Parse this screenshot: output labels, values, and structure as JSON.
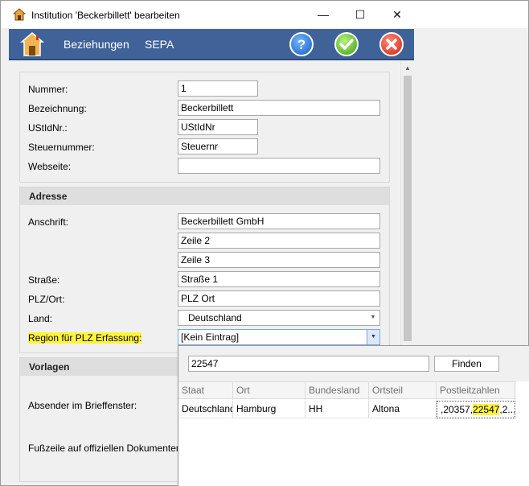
{
  "window": {
    "title": "Institution 'Beckerbillett' bearbeiten",
    "minimize": "—",
    "maximize": "☐",
    "close": "✕"
  },
  "toolbar": {
    "beziehungen": "Beziehungen",
    "sepa": "SEPA",
    "help": "?"
  },
  "general": {
    "nummer_label": "Nummer:",
    "nummer_value": "1",
    "bezeichnung_label": "Bezeichnung:",
    "bezeichnung_value": "Beckerbillett",
    "ustid_label": "UStIdNr.:",
    "ustid_value": "UStIdNr",
    "steuernummer_label": "Steuernummer:",
    "steuernummer_value": "Steuernr",
    "webseite_label": "Webseite:",
    "webseite_value": ""
  },
  "adresse": {
    "header": "Adresse",
    "anschrift_label": "Anschrift:",
    "anschrift_line1": "Beckerbillett GmbH",
    "anschrift_line2": "Zeile 2",
    "anschrift_line3": "Zeile 3",
    "strasse_label": "Straße:",
    "strasse_value": "Straße 1",
    "plz_label": "PLZ/Ort:",
    "plz_value": "PLZ Ort",
    "land_label": "Land:",
    "land_value": "Deutschland",
    "region_label": "Region für PLZ Erfassung:",
    "region_value": "[Kein Eintrag]"
  },
  "vorlagen": {
    "header": "Vorlagen",
    "absender_label": "Absender im Brieffenster:",
    "fusszeile_label": "Fußzeile auf offiziellen Dokumenten:"
  },
  "popup": {
    "search_value": "22547",
    "find_button": "Finden",
    "columns": [
      "Staat",
      "Ort",
      "Bundesland",
      "Ortsteil",
      "Postleitzahlen"
    ],
    "row": {
      "staat": "Deutschland",
      "ort": "Hamburg",
      "bundesland": "HH",
      "ortsteil": "Altona",
      "plz_prefix": ",20357,",
      "plz_match": "22547",
      "plz_suffix": ",2..."
    }
  },
  "colors": {
    "toolbar_bg": "#3f6399",
    "highlight": "#fff43a"
  }
}
